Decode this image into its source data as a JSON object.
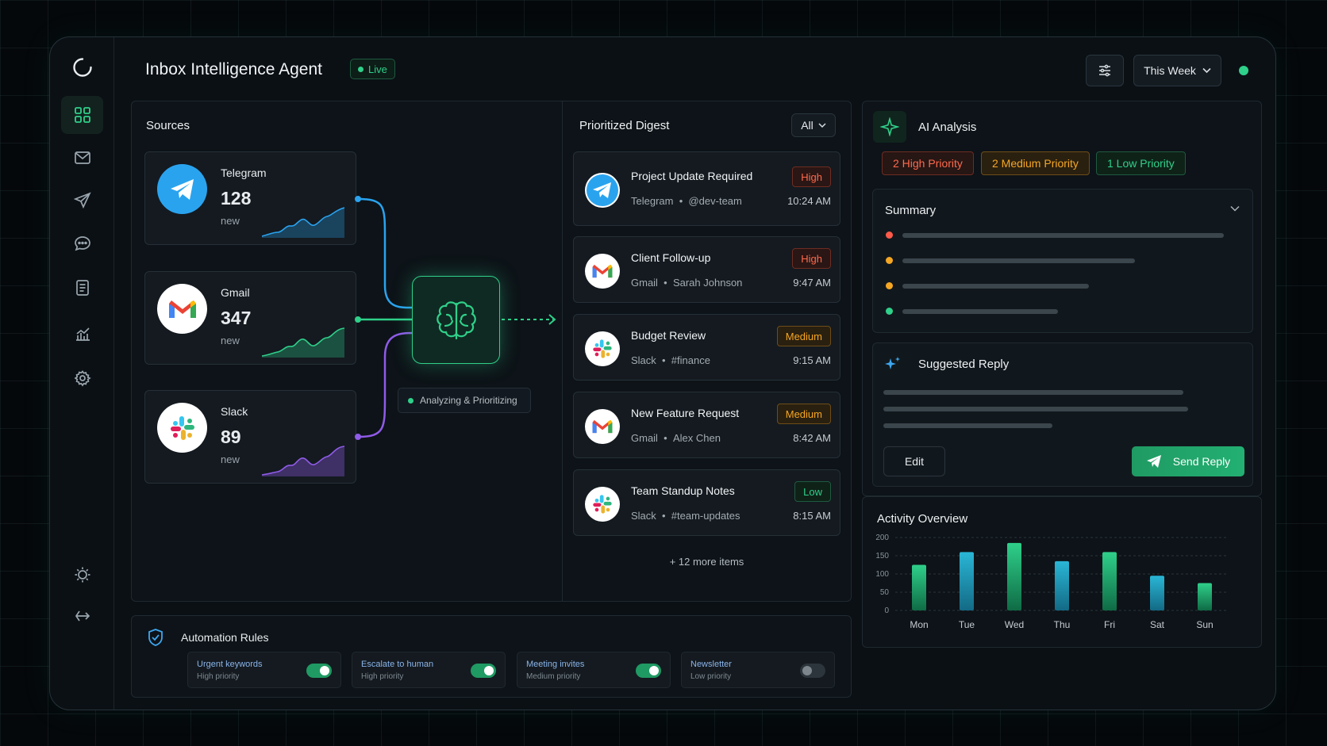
{
  "header": {
    "title": "Inbox Intelligence Agent",
    "live": "Live",
    "period": "This Week"
  },
  "sources": {
    "title": "Sources",
    "items": [
      {
        "name": "Telegram",
        "count": "128",
        "label": "new",
        "color": "#2aa3ef"
      },
      {
        "name": "Gmail",
        "count": "347",
        "label": "new",
        "color": "#2fd08a"
      },
      {
        "name": "Slack",
        "count": "89",
        "label": "new",
        "color": "#8f5be8"
      }
    ]
  },
  "processor": {
    "status": "Analyzing & Prioritizing"
  },
  "digest": {
    "title": "Prioritized Digest",
    "filter": "All",
    "more": "+ 12 more items",
    "items": [
      {
        "subject": "Project Update Required",
        "source": "Telegram",
        "sender": "@dev-team",
        "priority": "High",
        "time": "10:24 AM",
        "icon": "telegram-icon"
      },
      {
        "subject": "Client Follow-up",
        "source": "Gmail",
        "sender": "Sarah Johnson",
        "priority": "High",
        "time": "9:47 AM",
        "icon": "gmail-icon"
      },
      {
        "subject": "Budget Review",
        "source": "Slack",
        "sender": "#finance",
        "priority": "Medium",
        "time": "9:15 AM",
        "icon": "slack-icon"
      },
      {
        "subject": "New Feature Request",
        "source": "Gmail",
        "sender": "Alex Chen",
        "priority": "Medium",
        "time": "8:42 AM",
        "icon": "gmail-icon"
      },
      {
        "subject": "Team Standup Notes",
        "source": "Slack",
        "sender": "#team-updates",
        "priority": "Low",
        "time": "8:15 AM",
        "icon": "slack-icon"
      }
    ]
  },
  "analysis": {
    "title": "AI Analysis",
    "counts": [
      "2 High Priority",
      "2 Medium Priority",
      "1 Low Priority"
    ],
    "summary_title": "Summary",
    "summary_dots": [
      "#ff5a4a",
      "#f5a623",
      "#f5a623",
      "#2fd08a"
    ]
  },
  "reply": {
    "title": "Suggested Reply",
    "edit": "Edit",
    "send": "Send Reply"
  },
  "activity": {
    "title": "Activity Overview"
  },
  "chart_data": {
    "type": "bar",
    "title": "Activity Overview",
    "categories": [
      "Mon",
      "Tue",
      "Wed",
      "Thu",
      "Fri",
      "Sat",
      "Sun"
    ],
    "values": [
      125,
      160,
      185,
      135,
      160,
      95,
      75
    ],
    "yticks": [
      0,
      50,
      100,
      150,
      200
    ],
    "ylim": [
      0,
      200
    ],
    "grid": true
  },
  "automation": {
    "title": "Automation Rules",
    "rules": [
      {
        "name": "Urgent keywords",
        "priority": "High priority",
        "on": true
      },
      {
        "name": "Escalate to human",
        "priority": "High priority",
        "on": true
      },
      {
        "name": "Meeting invites",
        "priority": "Medium priority",
        "on": true
      },
      {
        "name": "Newsletter",
        "priority": "Low priority",
        "on": false
      }
    ]
  }
}
